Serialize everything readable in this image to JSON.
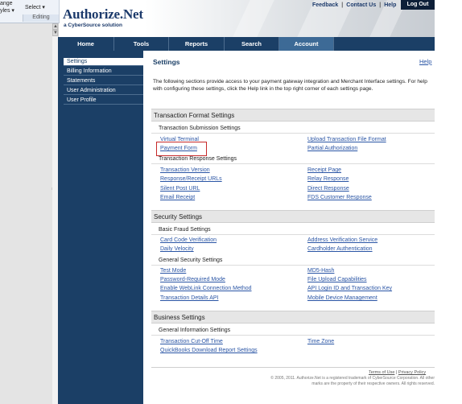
{
  "ribbon": {
    "change": "ange",
    "styles": "yles ▾",
    "select": "Select ▾",
    "group": "Editing"
  },
  "header": {
    "logo": "Authorize.Net",
    "tagline": "a CyberSource solution",
    "links": [
      "Feedback",
      "Contact Us",
      "Help"
    ],
    "logout": "Log Out"
  },
  "nav": {
    "tabs": [
      "Home",
      "Tools",
      "Reports",
      "Search",
      "Account"
    ],
    "active": "Account"
  },
  "sidebar": {
    "items": [
      "Settings",
      "Billing Information",
      "Statements",
      "User Administration",
      "User Profile"
    ],
    "active": "Settings"
  },
  "page": {
    "title": "Settings",
    "help": "Help",
    "intro": "The following sections provide access to your payment gateway integration and Merchant Interface settings. For help with configuring these settings, click the Help link in the top right corner of each settings page."
  },
  "sections": {
    "transaction_format": {
      "title": "Transaction Format Settings",
      "submission": {
        "title": "Transaction Submission Settings",
        "left": [
          "Virtual Terminal",
          "Payment Form"
        ],
        "right": [
          "Upload Transaction File Format",
          "Partial Authorization"
        ]
      },
      "response": {
        "title": "Transaction Response Settings",
        "left": [
          "Transaction Version",
          "Response/Receipt URLs",
          "Silent Post URL",
          "Email Receipt"
        ],
        "right": [
          "Receipt Page",
          "Relay Response",
          "Direct Response",
          "FDS Customer Response"
        ]
      }
    },
    "security": {
      "title": "Security Settings",
      "fraud": {
        "title": "Basic Fraud Settings",
        "left": [
          "Card Code Verification",
          "Daily Velocity"
        ],
        "right": [
          "Address Verification Service",
          "Cardholder Authentication"
        ]
      },
      "general": {
        "title": "General Security Settings",
        "left": [
          "Test Mode",
          "Password-Required Mode",
          "Enable WebLink Connection Method",
          "Transaction Details API"
        ],
        "right": [
          "MD5-Hash",
          "File Upload Capabilities",
          "API Login ID and Transaction Key",
          "Mobile Device Management"
        ]
      }
    },
    "business": {
      "title": "Business Settings",
      "general": {
        "title": "General Information Settings",
        "left": [
          "Transaction Cut-Off Time",
          "QuickBooks Download Report Settings"
        ],
        "right": [
          "Time Zone"
        ]
      }
    }
  },
  "footer": {
    "terms": "Terms of Use",
    "sep": " | ",
    "privacy": "Privacy Policy",
    "copyright": "© 2005, 2011. Authorize.Net is a registered trademark of CyberSource Corporation. All other marks are the property of their respective owners. All rights reserved."
  },
  "colors": {
    "nav": "#1b3f66",
    "nav_active": "#3d6a96",
    "link": "#2a55a5",
    "highlight": "#c62828"
  }
}
